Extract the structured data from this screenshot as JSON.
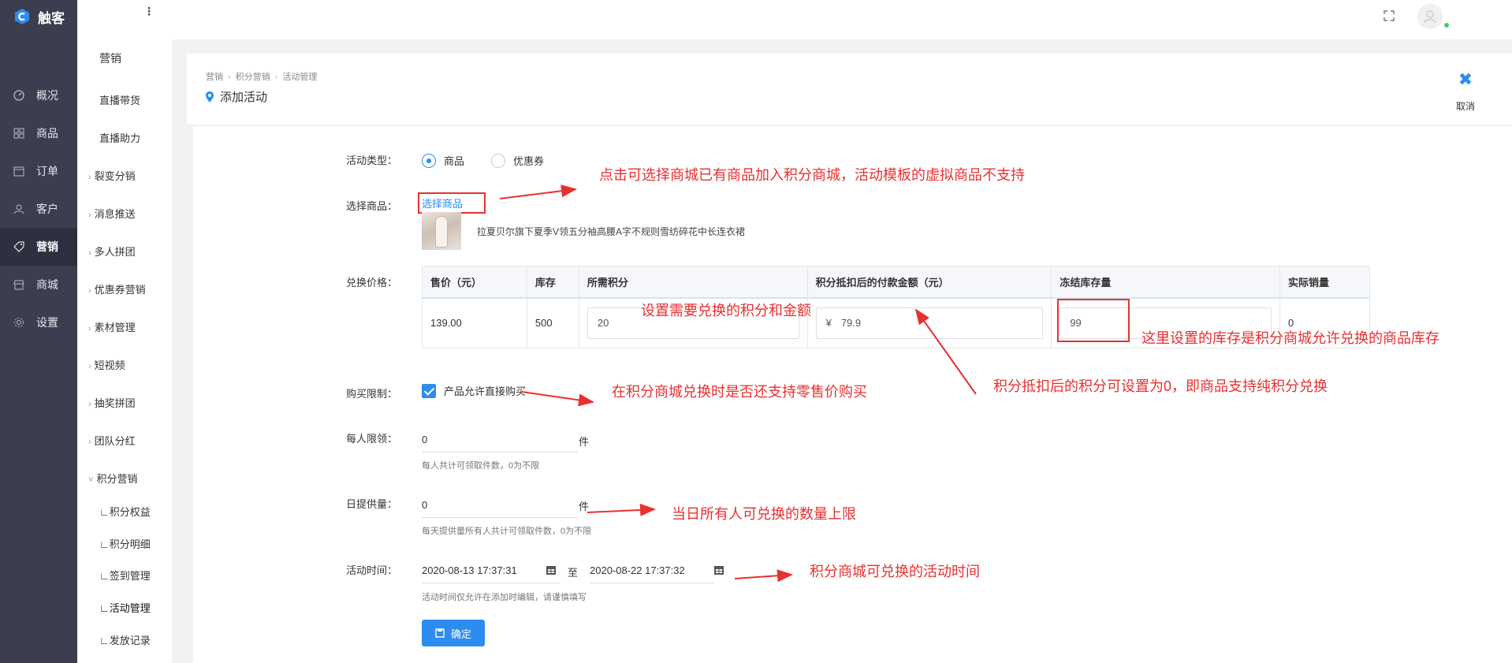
{
  "brand": {
    "name": "触客"
  },
  "sidebar": {
    "items": [
      {
        "label": "概况",
        "icon": "dashboard-icon"
      },
      {
        "label": "商品",
        "icon": "grid-icon"
      },
      {
        "label": "订单",
        "icon": "calendar-icon"
      },
      {
        "label": "客户",
        "icon": "user-icon"
      },
      {
        "label": "营销",
        "icon": "tag-icon",
        "active": true
      },
      {
        "label": "商城",
        "icon": "shop-icon"
      },
      {
        "label": "设置",
        "icon": "gear-icon"
      }
    ]
  },
  "submenu": {
    "heading": "营销",
    "items": [
      {
        "label": "直播带货"
      },
      {
        "label": "直播助力"
      },
      {
        "label": "裂变分销"
      },
      {
        "label": "消息推送"
      },
      {
        "label": "多人拼团"
      },
      {
        "label": "优惠券营销"
      },
      {
        "label": "素材管理"
      },
      {
        "label": "短视频"
      },
      {
        "label": "抽奖拼团"
      },
      {
        "label": "团队分红"
      },
      {
        "label": "积分营销"
      },
      {
        "label": "∟积分权益"
      },
      {
        "label": "∟积分明细"
      },
      {
        "label": "∟签到管理"
      },
      {
        "label": "∟活动管理"
      },
      {
        "label": "∟发放记录"
      }
    ]
  },
  "header": {
    "breadcrumb": [
      "营销",
      "积分营销",
      "活动管理"
    ],
    "title": "添加活动",
    "cancel_label": "取消"
  },
  "form": {
    "type_label": "活动类型：",
    "type_options": [
      "商品",
      "优惠券"
    ],
    "select_label": "选择商品：",
    "select_link": "选择商品",
    "product_name": "拉夏贝尔旗下夏季V领五分袖高腰A字不规则雪纺碎花中长连衣裙",
    "price_label": "兑换价格：",
    "table": {
      "headers": [
        "售价（元）",
        "库存",
        "所需积分",
        "积分抵扣后的付款金额（元）",
        "冻结库存量",
        "实际销量"
      ],
      "row": {
        "price": "139.00",
        "stock": "500",
        "points": "20",
        "currency": "¥",
        "pay": "79.9",
        "frozen": "99",
        "sold": "0"
      }
    },
    "limit_label": "购买限制：",
    "limit_checkbox": "产品允许直接购买",
    "per_person_label": "每人限领：",
    "per_person_value": "0",
    "unit": "件",
    "per_person_hint": "每人共计可领取件数，0为不限",
    "daily_label": "日提供量：",
    "daily_value": "0",
    "daily_hint": "每天提供量所有人共计可领取件数，0为不限",
    "time_label": "活动时间：",
    "time_start": "2020-08-13 17:37:31",
    "time_to": "至",
    "time_end": "2020-08-22 17:37:32",
    "time_hint": "活动时间仅允许在添加时编辑，请谨慎填写",
    "submit_label": "确定"
  },
  "annotations": {
    "a1": "点击可选择商城已有商品加入积分商城，活动模板的虚拟商品不支持",
    "a2": "设置需要兑换的积分和金额",
    "a3": "这里设置的库存是积分商城允许兑换的商品库存",
    "a4": "积分抵扣后的积分可设置为0，即商品支持纯积分兑换",
    "a5": "在积分商城兑换时是否还支持零售价购买",
    "a6": "当日所有人可兑换的数量上限",
    "a7": "积分商城可兑换的活动时间"
  },
  "colors": {
    "primary": "#2d8cf0",
    "annotation": "#e8302f",
    "sidebar": "#3b3e4f"
  }
}
